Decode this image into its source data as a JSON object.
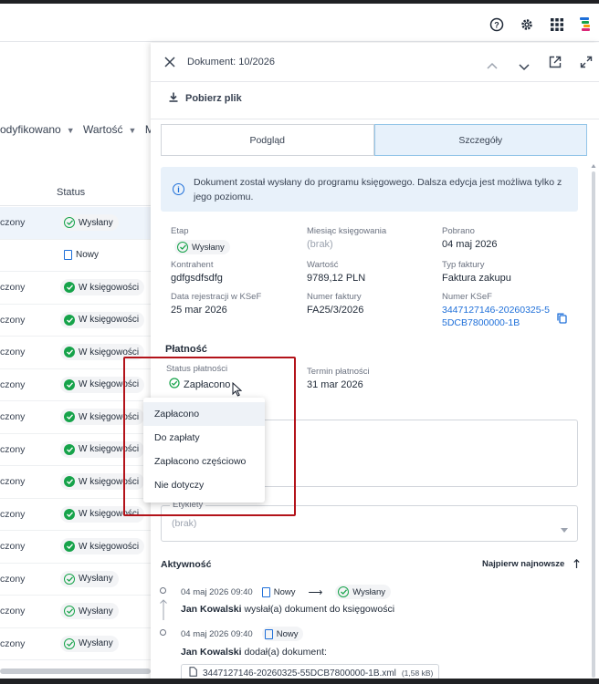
{
  "topbar": {
    "help_icon": "help-circle-icon",
    "settings_icon": "gear-icon",
    "apps_icon": "grid-apps-icon",
    "logo_icon": "brand-logo-icon"
  },
  "list": {
    "filters": [
      "odyfikowano",
      "Wartość",
      "M"
    ],
    "status_header": "Status",
    "rows": [
      {
        "c1": "czony",
        "status": "Wysłany",
        "kind": "sent",
        "selected": true
      },
      {
        "c1": "",
        "status": "Nowy",
        "kind": "new"
      },
      {
        "c1": "czony",
        "status": "W księgowości",
        "kind": "acc"
      },
      {
        "c1": "czony",
        "status": "W księgowości",
        "kind": "acc"
      },
      {
        "c1": "czony",
        "status": "W księgowości",
        "kind": "acc"
      },
      {
        "c1": "czony",
        "status": "W księgowości",
        "kind": "acc"
      },
      {
        "c1": "czony",
        "status": "W księgowości",
        "kind": "acc"
      },
      {
        "c1": "czony",
        "status": "W księgowości",
        "kind": "acc"
      },
      {
        "c1": "czony",
        "status": "W księgowości",
        "kind": "acc"
      },
      {
        "c1": "czony",
        "status": "W księgowości",
        "kind": "acc"
      },
      {
        "c1": "czony",
        "status": "W księgowości",
        "kind": "acc"
      },
      {
        "c1": "czony",
        "status": "Wysłany",
        "kind": "sent"
      },
      {
        "c1": "czony",
        "status": "Wysłany",
        "kind": "sent"
      },
      {
        "c1": "czony",
        "status": "Wysłany",
        "kind": "sent"
      }
    ]
  },
  "panel": {
    "title": "Dokument: 10/2026",
    "download_label": "Pobierz plik",
    "tabs": [
      "Podgląd",
      "Szczegóły"
    ],
    "active_tab": 1,
    "info_text": "Dokument został wysłany do programu księgowego. Dalsza edycja jest możliwa tylko z jego poziomu.",
    "details": {
      "etap_label": "Etap",
      "etap_value": "Wysłany",
      "miesiac_label": "Miesiąc księgowania",
      "miesiac_value": "(brak)",
      "pobrano_label": "Pobrano",
      "pobrano_value": "04 maj 2026",
      "kontrahent_label": "Kontrahent",
      "kontrahent_value": "gdfgsdfsdfg",
      "wartosc_label": "Wartość",
      "wartosc_value": "9789,12 PLN",
      "typ_label": "Typ faktury",
      "typ_value": "Faktura zakupu",
      "data_rej_label": "Data rejestracji w KSeF",
      "data_rej_value": "25 mar 2026",
      "numer_faktury_label": "Numer faktury",
      "numer_faktury_value": "FA25/3/2026",
      "numer_ksef_label": "Numer KSeF",
      "numer_ksef_line1": "3447127146-20260325-5",
      "numer_ksef_line2": "5DCB7800000-1B"
    },
    "payment": {
      "section_title": "Płatność",
      "status_label": "Status płatności",
      "status_value": "Zapłacono",
      "termin_label": "Termin płatności",
      "termin_value": "31 mar 2026",
      "options": [
        "Zapłacono",
        "Do zapłaty",
        "Zapłacono częściowo",
        "Nie dotyczy"
      ],
      "highlighted_option": 0
    },
    "tags": {
      "label": "Etykiety",
      "placeholder": "(brak)"
    },
    "activity": {
      "title": "Aktywność",
      "sort_label": "Najpierw najnowsze",
      "entries": [
        {
          "timestamp": "04 maj 2026 09:40",
          "from": "Nowy",
          "to": "Wysłany",
          "user": "Jan Kowalski",
          "text": "wysłał(a) dokument do księgowości"
        },
        {
          "timestamp": "04 maj 2026 09:40",
          "from": "Nowy",
          "user": "Jan Kowalski",
          "text": "dodał(a) dokument:",
          "file_name": "3447127146-20260325-55DCB7800000-1B.xml",
          "file_size": "(1,58 kB)"
        }
      ]
    }
  },
  "colors": {
    "accent": "#1e6fd9",
    "success": "#16a34a",
    "highlight_box": "#b3131a",
    "tab_active_bg": "#e7f1fb"
  }
}
